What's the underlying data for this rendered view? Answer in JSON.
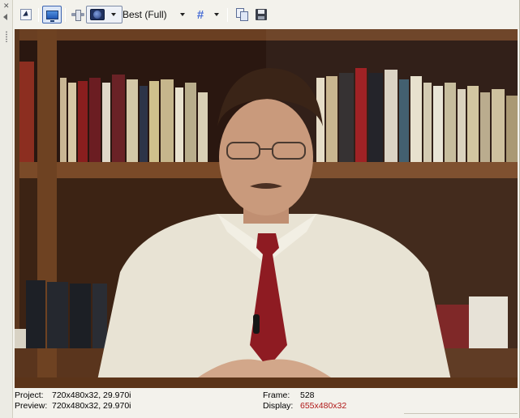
{
  "toolbar": {
    "quality_label": "Best (Full)",
    "icons": [
      "select-icon",
      "monitor-icon",
      "split-screen-icon",
      "overlay-icon",
      "grid-icon",
      "copy-snapshot-icon",
      "save-snapshot-icon"
    ]
  },
  "preview": {
    "description_icon": "video-frame"
  },
  "status": {
    "project_label": "Project:",
    "project_value": "720x480x32, 29.970i",
    "preview_label": "Preview:",
    "preview_value": "720x480x32, 29.970i",
    "frame_label": "Frame:",
    "frame_value": "528",
    "display_label": "Display:",
    "display_value": "655x480x32"
  },
  "colors": {
    "display_value": "#b01717",
    "toolbar_bg": "#f3f2ec"
  }
}
